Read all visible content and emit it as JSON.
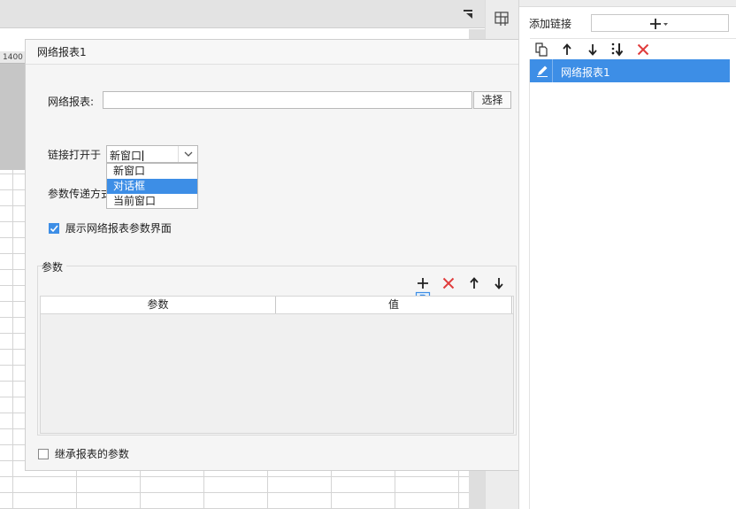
{
  "ruler": {
    "label": "1400"
  },
  "dialog": {
    "title": "网络报表1",
    "report_label": "网络报表:",
    "report_value": "",
    "choose_button": "选择",
    "open_in_label": "链接打开于",
    "open_in_value": "新窗口",
    "open_in_options": [
      "新窗口",
      "对话框",
      "当前窗口"
    ],
    "open_in_highlighted": "对话框",
    "param_pass_label": "参数传递方式",
    "show_params_label": "展示网络报表参数界面",
    "show_params_checked": true,
    "params_group_title": "参数",
    "params_columns": [
      "参数",
      "值"
    ],
    "params_rows": [],
    "inherit_label": "继承报表的参数",
    "inherit_checked": false
  },
  "right_panel": {
    "add_link_label": "添加链接",
    "links": [
      "网络报表1"
    ]
  },
  "colors": {
    "accent": "#3d8ee6",
    "delete": "#e03c3c"
  }
}
